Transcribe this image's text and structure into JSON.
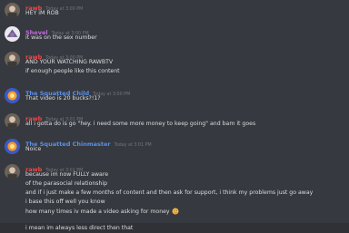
{
  "colors": {
    "background": "#36393f",
    "rawb": "#f04747",
    "shevel": "#c26bde",
    "blue_user": "#5b8fe8"
  },
  "messages": [
    {
      "username": "rawb",
      "timestamp": "Today at 3:00 PM",
      "lines": [
        "HEY iM ROB"
      ]
    },
    {
      "username": "Shevel",
      "timestamp": "Today at 3:00 PM",
      "lines": [
        "it was on the sex number"
      ]
    },
    {
      "username": "rawb",
      "timestamp": "Today at 3:00 PM",
      "lines": [
        "AND YOUR WATCHING RAWBTV",
        "if enough people like this content"
      ]
    },
    {
      "username": "The Squatted Child",
      "timestamp": "Today at 3:00 PM",
      "lines": [
        "That video is 20 bucks?!1?"
      ]
    },
    {
      "username": "rawb",
      "timestamp": "Today at 3:01 PM",
      "lines": [
        "all i gotta do is go \"hey. i need some more money to keep going\" and bam it goes"
      ]
    },
    {
      "username": "The Squatted Chinmaster",
      "timestamp": "Today at 3:01 PM",
      "lines": [
        "Noice"
      ]
    },
    {
      "username": "rawb",
      "timestamp": "Today at 3:01 PM",
      "lines": [
        "because im now FULLY aware",
        "of the parasocial relationship",
        "and if i just make a few months of content and then ask for support, i think my problems just go away",
        "i base this off well you know",
        "how many times iv made a video asking for money",
        "i mean im always less direct then that"
      ],
      "emoji": "face-with-hand-over-mouth-icon"
    }
  ]
}
